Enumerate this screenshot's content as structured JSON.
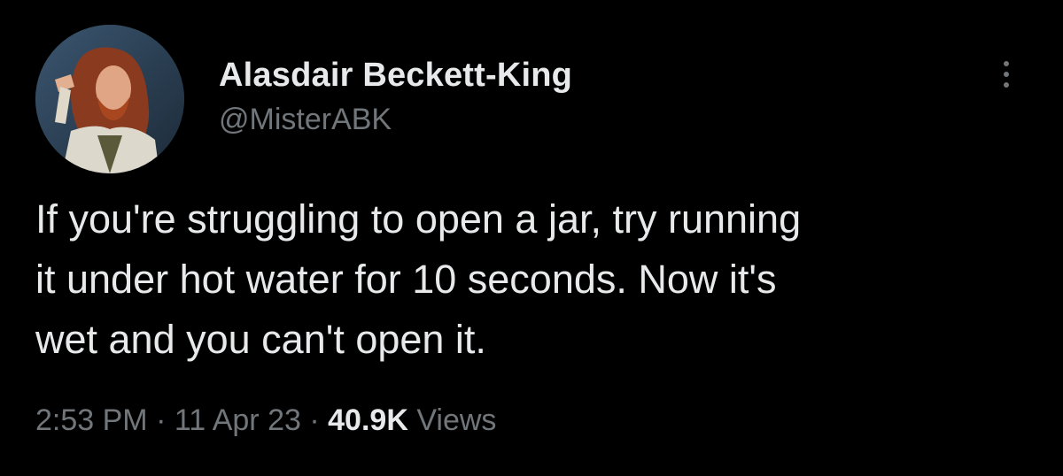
{
  "author": {
    "display_name": "Alasdair Beckett-King",
    "handle": "@MisterABK"
  },
  "tweet": {
    "text_lines": [
      "If you're struggling to open a jar, try running",
      "it under hot water for 10 seconds. Now it's",
      "wet and you can't open it."
    ]
  },
  "meta": {
    "time": "2:53 PM",
    "separator": "·",
    "date": "11 Apr 23",
    "views_count": "40.9K",
    "views_label": "Views"
  },
  "icons": {
    "more": "more-dots-icon"
  },
  "colors": {
    "background": "#000000",
    "primary_text": "#e7e9ea",
    "secondary_text": "#71767b"
  }
}
